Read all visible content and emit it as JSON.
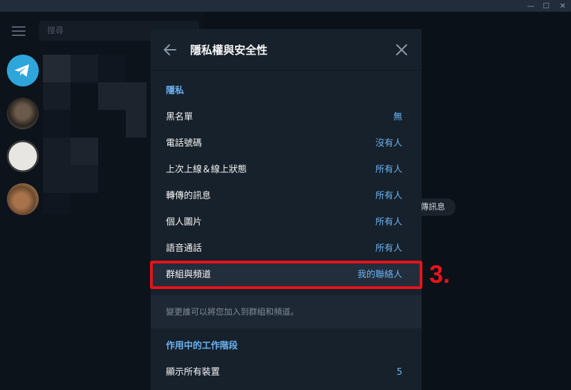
{
  "window": {
    "minimize_glyph": "—",
    "maximize_glyph": "☐",
    "close_glyph": "✕"
  },
  "sidebar": {
    "search_placeholder": "搜尋"
  },
  "chat_hint": "傳訊息",
  "dialog": {
    "title": "隱私權與安全性",
    "privacy_section": "隱私",
    "rows": [
      {
        "label": "黑名單",
        "value": "無"
      },
      {
        "label": "電話號碼",
        "value": "沒有人"
      },
      {
        "label": "上次上線＆線上狀態",
        "value": "所有人"
      },
      {
        "label": "轉傳的訊息",
        "value": "所有人"
      },
      {
        "label": "個人圖片",
        "value": "所有人"
      },
      {
        "label": "語音通話",
        "value": "所有人"
      },
      {
        "label": "群組與頻道",
        "value": "我的聯絡人"
      }
    ],
    "groups_note": "變更誰可以將您加入到群組和頻道。",
    "sessions_section": "作用中的工作階段",
    "sessions_row": {
      "label": "顯示所有裝置",
      "value": "5"
    }
  },
  "annotation": {
    "step": "3.",
    "color": "#e8131a"
  },
  "colors": {
    "accent": "#6ab2f2",
    "dialog_bg": "#17212b",
    "telegram_blue": "#2ea6dc"
  }
}
